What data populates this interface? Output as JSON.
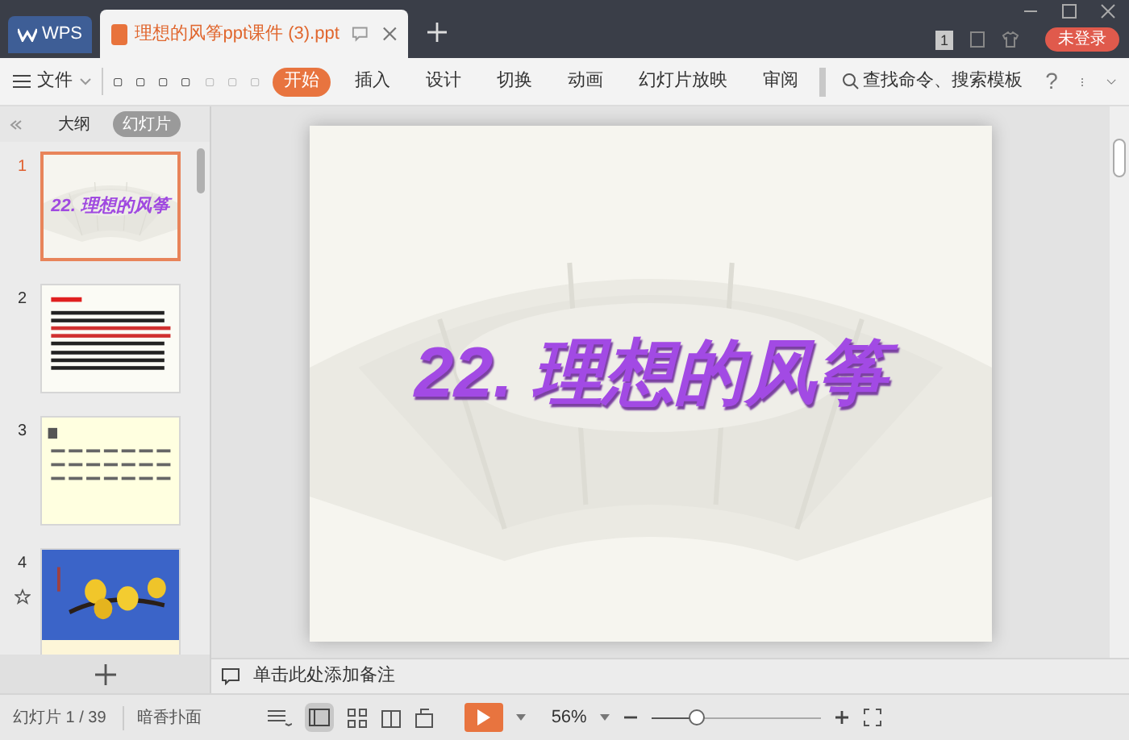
{
  "tabs": [
    {
      "label": "WPS",
      "kind": "home",
      "selected": false
    },
    {
      "label": "理想的风筝ppt课件 (3).ppt",
      "kind": "doc",
      "selected": true
    }
  ],
  "account": {
    "page_badge": "1",
    "login": "未登录"
  },
  "toolbar": {
    "file_menu": "文件",
    "ribbon_tabs": [
      {
        "label": "开始",
        "selected": true
      },
      {
        "label": "插入",
        "selected": false
      },
      {
        "label": "设计",
        "selected": false
      },
      {
        "label": "切换",
        "selected": false
      },
      {
        "label": "动画",
        "selected": false
      },
      {
        "label": "幻灯片放映",
        "selected": false
      },
      {
        "label": "审阅",
        "selected": false
      }
    ],
    "search": "查找命令、搜索模板",
    "help": "?"
  },
  "panel": {
    "tabs": [
      {
        "label": "大纲",
        "selected": false
      },
      {
        "label": "幻灯片",
        "selected": true
      }
    ],
    "thumbnails": [
      {
        "number": "1",
        "kind": "title",
        "title": "22. 理想的风筝",
        "selected": true
      },
      {
        "number": "2",
        "kind": "text",
        "selected": false
      },
      {
        "number": "3",
        "kind": "list",
        "selected": false
      },
      {
        "number": "4",
        "selected": false,
        "animated": true
      }
    ]
  },
  "slide": {
    "title": "22. 理想的风筝"
  },
  "notes": {
    "placeholder": "单击此处添加备注"
  },
  "status_bar": {
    "slide_count": "幻灯片 1 / 39",
    "theme": "暗香扑面",
    "zoom": "56%",
    "zoom_slider": {
      "level": 0.27
    }
  }
}
